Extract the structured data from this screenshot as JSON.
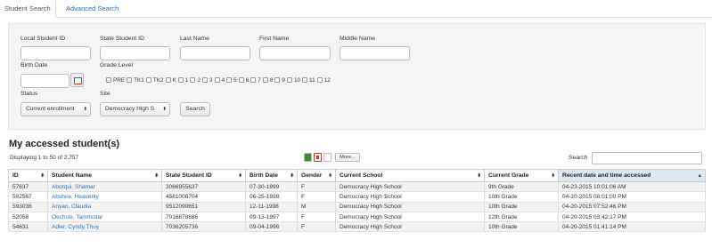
{
  "tabs": {
    "student_search": "Student Search",
    "advanced_search": "Advanced Search"
  },
  "filters": {
    "local_id_label": "Local Student ID",
    "state_id_label": "State Student ID",
    "last_name_label": "Last Name",
    "first_name_label": "First Name",
    "middle_name_label": "Middle Name",
    "birth_date_label": "Birth Date",
    "grade_level_label": "Grade Level",
    "grades": [
      "PRE",
      "TK1",
      "TK2",
      "K",
      "1",
      "2",
      "3",
      "4",
      "5",
      "6",
      "7",
      "8",
      "9",
      "10",
      "11",
      "12"
    ],
    "status_label": "Status",
    "status_value": "Current enrollment",
    "site_label": "Site",
    "site_value": "Democracy High S",
    "search_button": "Search",
    "select_arrow": "⬍"
  },
  "results": {
    "heading": "My accessed student(s)",
    "count_text": "Displaying 1 to 50 of 2,757",
    "more_button": "More...",
    "search_label": "Search",
    "columns": [
      "ID",
      "Student Name",
      "State Student ID",
      "Birth Date",
      "Gender",
      "Current School",
      "Current Grade",
      "Recent date and time accessed"
    ],
    "sort_icon": "⬍",
    "sorted_icon": "▲",
    "rows": [
      [
        "57637",
        "Aborqui, Shamar",
        "3066955637",
        "07-30-1999",
        "F",
        "Democracy High School",
        "9th Grade",
        "04-23-2015 10:01:06 AM"
      ],
      [
        "592567",
        "Abshire, Heavenly",
        "4561008704",
        "06-25-1998",
        "F",
        "Democracy High School",
        "10th Grade",
        "04-20-2015 08:01:00 PM"
      ],
      [
        "593036",
        "Anyan, Claudia",
        "9512090651",
        "12-11-1998",
        "M",
        "Democracy High School",
        "10th Grade",
        "04-20-2015 07:52:46 PM"
      ],
      [
        "52058",
        "Oechsle, Tamrisstar",
        "7016878686",
        "09-13-1997",
        "F",
        "Democracy High School",
        "12th Grade",
        "04-20-2015 03:42:17 PM"
      ],
      [
        "54631",
        "Adler, Cyndy Thuy",
        "7036205736",
        "09-04-1998",
        "F",
        "Democracy High School",
        "10th Grade",
        "04-20-2015 01:41:14 PM"
      ]
    ]
  }
}
